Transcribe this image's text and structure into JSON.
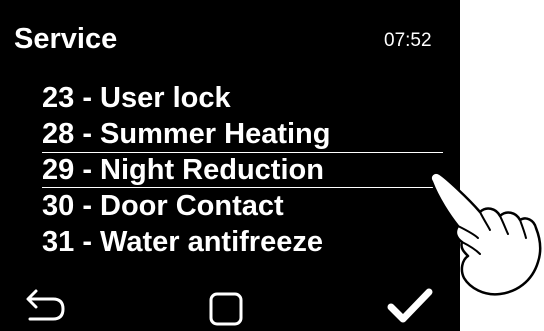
{
  "header": {
    "title": "Service",
    "time": "07:52"
  },
  "menu": {
    "selected_index": 2,
    "items": [
      {
        "label": "23 - User lock"
      },
      {
        "label": "28 - Summer Heating"
      },
      {
        "label": "29 - Night Reduction"
      },
      {
        "label": "30 - Door Contact"
      },
      {
        "label": "31 - Water antifreeze"
      }
    ]
  },
  "footer": {
    "buttons": [
      {
        "icon": "back-arrow-icon"
      },
      {
        "icon": "home-square-icon"
      },
      {
        "icon": "checkmark-icon"
      }
    ]
  },
  "colors": {
    "screen_background": "#000000",
    "text": "#ffffff",
    "page_background": "#ffffff"
  }
}
